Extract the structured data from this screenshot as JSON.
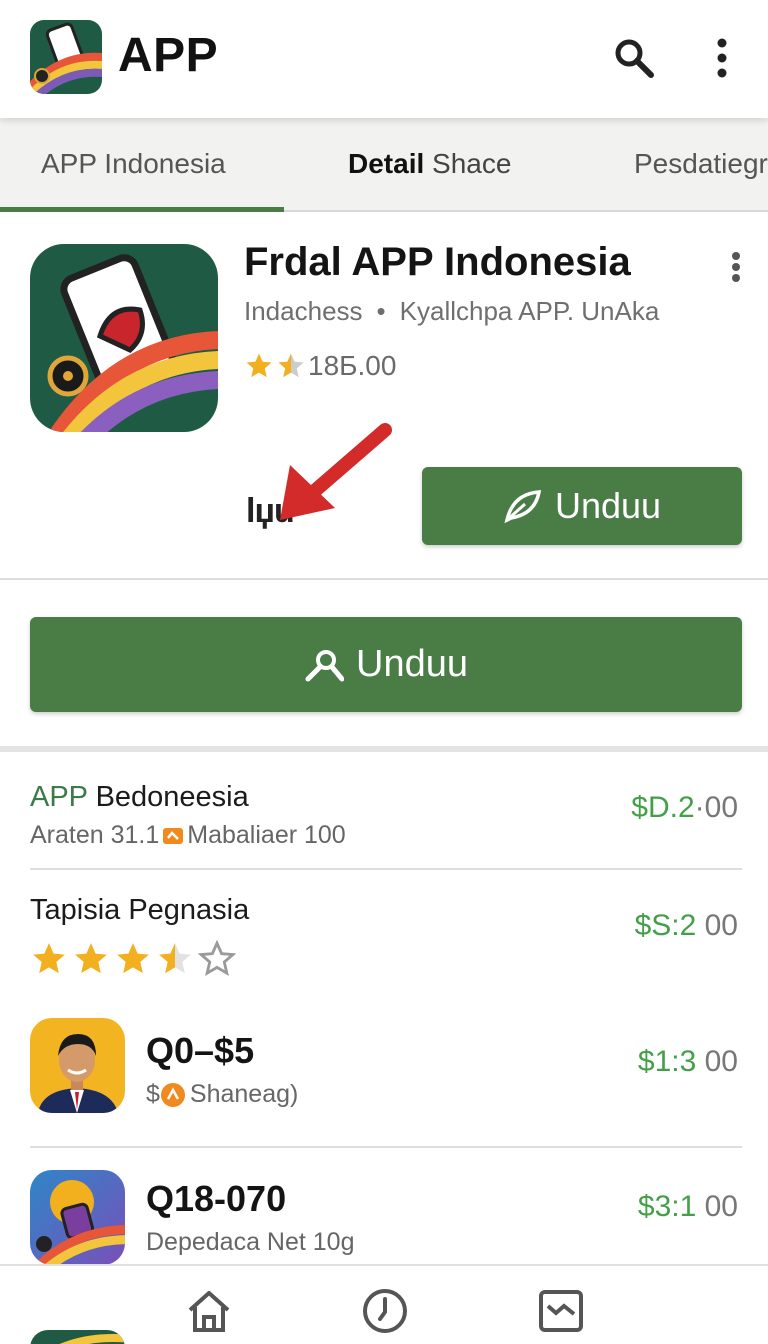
{
  "header": {
    "title": "APP",
    "icons": [
      "app-logo-icon",
      "search-icon",
      "more-vert-icon"
    ]
  },
  "tabs": [
    {
      "label": "APP Indonesia",
      "active": true
    },
    {
      "label_bold": "Detail",
      "label_rest": "Shace",
      "active": false
    },
    {
      "label": "Pesdatiegr",
      "active": false
    }
  ],
  "app": {
    "title": "Frdal APP Indonesia",
    "developer": "Indachess",
    "separator": "•",
    "category": "Kyallchpa APP. UnAka",
    "rating_text": "18Б.00",
    "rating_value": 1.5,
    "wordmark": "lџu",
    "install_small_label": "Unduu",
    "install_big_label": "Unduu"
  },
  "list": [
    {
      "title_green": "APP",
      "title_rest": " Bedoneesia",
      "sub_left": "Araten 31.1",
      "sub_right": "Mabaliaer 100",
      "price_main": "$D.2",
      "price_rest": "·00"
    },
    {
      "title": "Tapisia Pegnasia",
      "rating_value": 3.5,
      "price_main": "$S:2",
      "price_rest": " 00"
    },
    {
      "title": "Q0–$5",
      "sub_prefix": "$",
      "sub": "Shaneag)",
      "price_main": "$1:3",
      "price_rest": " 00"
    },
    {
      "title": "Q18-070",
      "sub": "Depedaca Net 10g",
      "price_main": "$3:1",
      "price_rest": " 00"
    }
  ],
  "bottom_nav": [
    "home-icon",
    "clock-icon",
    "inbox-icon"
  ],
  "colors": {
    "brand_green": "#4a7d46",
    "price_green": "#44a048",
    "star": "#f2b01e",
    "arrow_red": "#d32a2a"
  }
}
